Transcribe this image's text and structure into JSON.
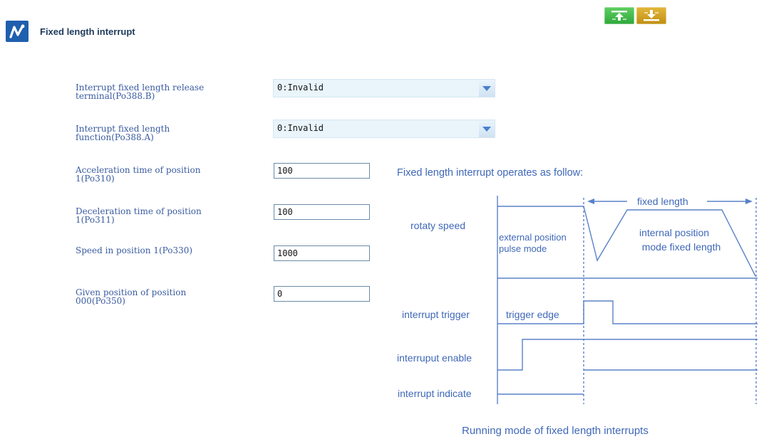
{
  "header": {
    "title": "Fixed length interrupt",
    "logo_icon": "waveform-icon",
    "upload_icon": "upload-icon",
    "download_icon": "download-icon"
  },
  "form": {
    "fields": [
      {
        "label": "Interrupt fixed length release\nterminal(Po388.B)",
        "type": "select",
        "value": "0:Invalid"
      },
      {
        "label": "Interrupt fixed length\nfunction(Po388.A)",
        "type": "select",
        "value": "0:Invalid"
      },
      {
        "label": "Acceleration time of position\n1(Po310)",
        "type": "input",
        "value": "100"
      },
      {
        "label": "Deceleration time of position\n1(Po311)",
        "type": "input",
        "value": "100"
      },
      {
        "label": "Speed in position 1(Po330)",
        "type": "input",
        "value": "1000"
      },
      {
        "label": "Given position of position\n000(Po350)",
        "type": "input",
        "value": "0"
      }
    ]
  },
  "diagram": {
    "heading": "Fixed length interrupt operates as follow:",
    "fixed_length": "fixed length",
    "rotaty_speed": "rotaty speed",
    "external_line1": "external position",
    "external_line2": "pulse mode",
    "internal_line1": "internal position",
    "internal_line2": "mode fixed length",
    "interrupt_trigger": "interrupt trigger",
    "trigger_edge": "trigger edge",
    "interrupt_enable": "interruput enable",
    "interrupt_indicate": "interrupt indicate",
    "caption": "Running mode of fixed length interrupts",
    "line_color": "#5a82c8",
    "text_color": "#3f68b8"
  },
  "colors": {
    "accent": "#1f5fae",
    "label": "#3a5ba0",
    "upload_button": "#3fb84a",
    "download_button": "#d4a423"
  }
}
